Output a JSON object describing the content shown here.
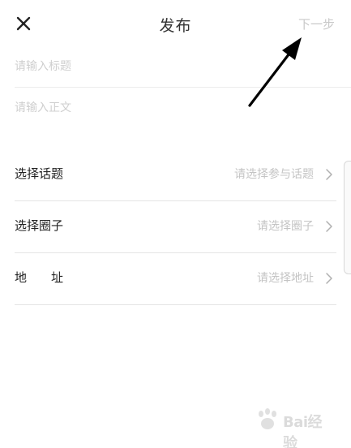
{
  "header": {
    "title": "发布",
    "next_label": "下一步",
    "close_icon": "close-icon"
  },
  "inputs": {
    "title_placeholder": "请输入标题",
    "body_placeholder": "请输入正文"
  },
  "rows": [
    {
      "label": "选择话题",
      "placeholder": "请选择参与话题",
      "icon": "chevron-right-icon"
    },
    {
      "label": "选择圈子",
      "placeholder": "请选择圈子",
      "icon": "chevron-right-icon"
    },
    {
      "label": "地　　址",
      "placeholder": "请选择地址",
      "icon": "chevron-right-icon"
    }
  ],
  "annotation": {
    "icon": "arrow-pointer-icon",
    "color": "#000000"
  },
  "watermark": {
    "text": "Bai经验",
    "icon": "baidu-paw-logo"
  },
  "colors": {
    "placeholder": "#c8c8c8",
    "text": "#222222",
    "divider": "#e4e4e4"
  }
}
